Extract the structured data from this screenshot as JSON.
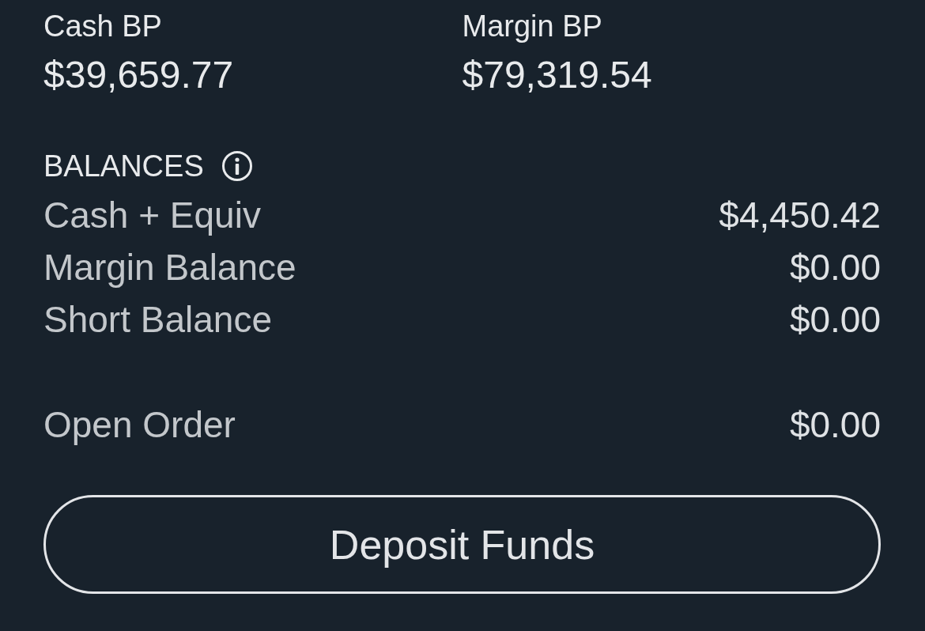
{
  "buying_power": [
    {
      "label": "Cash BP",
      "value": "$39,659.77"
    },
    {
      "label": "Margin BP",
      "value": "$79,319.54"
    }
  ],
  "balances": {
    "title": "BALANCES",
    "rows": [
      {
        "label": "Cash + Equiv",
        "value": "$4,450.42"
      },
      {
        "label": "Margin Balance",
        "value": "$0.00"
      },
      {
        "label": "Short Balance",
        "value": "$0.00"
      }
    ]
  },
  "open_order": {
    "label": "Open Order",
    "value": "$0.00"
  },
  "deposit_button": {
    "label": "Deposit Funds"
  }
}
